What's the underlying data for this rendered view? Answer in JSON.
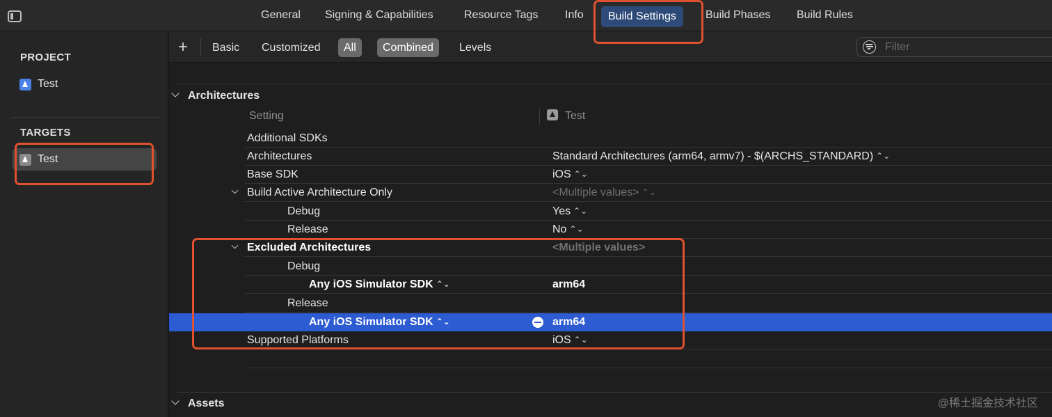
{
  "top_tabs": [
    {
      "label": "General"
    },
    {
      "label": "Signing & Capabilities"
    },
    {
      "label": "Resource Tags"
    },
    {
      "label": "Info"
    },
    {
      "label": "Build Settings",
      "active": true
    },
    {
      "label": "Build Phases"
    },
    {
      "label": "Build Rules"
    }
  ],
  "sidebar": {
    "project_title": "PROJECT",
    "project_items": [
      {
        "label": "Test",
        "icon": "xcode-project-icon"
      }
    ],
    "targets_title": "TARGETS",
    "target_items": [
      {
        "label": "Test",
        "icon": "app-target-icon",
        "selected": true
      }
    ]
  },
  "toolbar": {
    "add_label": "+",
    "segments": [
      {
        "label": "Basic"
      },
      {
        "label": "Customized"
      },
      {
        "label": "All",
        "selected": true
      },
      {
        "label": "Combined",
        "selected": true
      },
      {
        "label": "Levels"
      }
    ],
    "filter_placeholder": "Filter"
  },
  "sections": {
    "architectures": "Architectures",
    "assets": "Assets"
  },
  "columns": {
    "setting": "Setting",
    "target": "Test"
  },
  "rows": [
    {
      "name": "Additional SDKs",
      "value": ""
    },
    {
      "name": "Architectures",
      "value": "Standard Architectures (arm64, armv7)  -  $(ARCHS_STANDARD)",
      "stepper": "⌃⌄"
    },
    {
      "name": "Base SDK",
      "value": "iOS",
      "stepper": "⌃⌄"
    },
    {
      "name": "Build Active Architecture Only",
      "value": "<Multiple values>",
      "stepper": "⌃⌄"
    },
    {
      "name": "Debug",
      "value": "Yes",
      "stepper": "⌃⌄"
    },
    {
      "name": "Release",
      "value": "No",
      "stepper": "⌃⌄"
    },
    {
      "name": "Excluded Architectures",
      "value": "<Multiple values>"
    },
    {
      "name": "Debug",
      "value": ""
    },
    {
      "name": "Any iOS Simulator SDK",
      "value": "arm64",
      "stepper": "⌃⌄"
    },
    {
      "name": "Release",
      "value": ""
    },
    {
      "name": "Any iOS Simulator SDK",
      "value": "arm64",
      "stepper": "⌃⌄",
      "selected": true
    },
    {
      "name": "Supported Platforms",
      "value": "iOS",
      "stepper": "⌃⌄"
    }
  ],
  "watermark": "@稀土掘金技术社区",
  "colors": {
    "selection": "#2c5bd2",
    "annotation": "#e0522f",
    "active_tab": "#2e4a78"
  }
}
